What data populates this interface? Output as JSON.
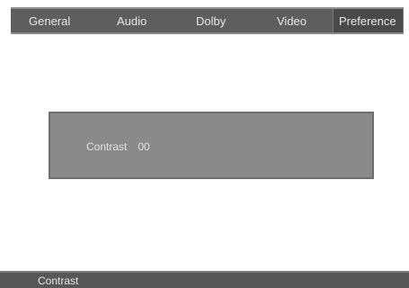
{
  "menu": {
    "tabs": [
      {
        "label": "General"
      },
      {
        "label": "Audio"
      },
      {
        "label": "Dolby"
      },
      {
        "label": "Video"
      },
      {
        "label": "Preference"
      }
    ],
    "active_tab": "Preference"
  },
  "panel": {
    "setting_label": "Contrast",
    "setting_value": "00"
  },
  "status": {
    "text": "Contrast"
  },
  "colors": {
    "menu_bar": "#5e5e5e",
    "active_tab": "#4a4a4a",
    "panel": "#8a8a8a",
    "status_bar": "#575757",
    "text": "#e6e6e6"
  }
}
